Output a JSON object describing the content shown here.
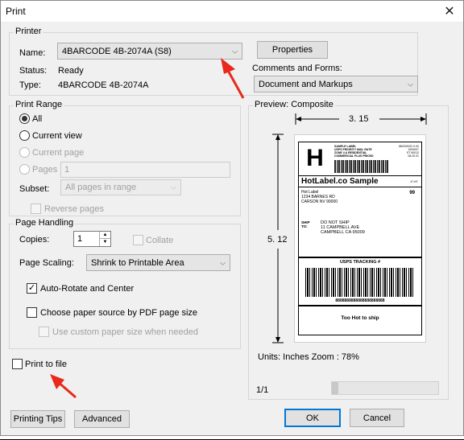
{
  "window": {
    "title": "Print",
    "close_glyph": "✕"
  },
  "printer": {
    "group_label": "Printer",
    "name_label": "Name:",
    "name_value": "4BARCODE 4B-2074A (S8)",
    "status_label": "Status:",
    "status_value": "Ready",
    "type_label": "Type:",
    "type_value": "4BARCODE 4B-2074A",
    "properties_button": "Properties",
    "comments_label": "Comments and Forms:",
    "comments_value": "Document and Markups"
  },
  "print_range": {
    "group_label": "Print Range",
    "all_label": "All",
    "current_view_label": "Current view",
    "current_page_label": "Current page",
    "pages_label": "Pages",
    "pages_value": "1",
    "subset_label": "Subset:",
    "subset_value": "All pages in range",
    "reverse_label": "Reverse pages"
  },
  "page_handling": {
    "group_label": "Page Handling",
    "copies_label": "Copies:",
    "copies_value": "1",
    "collate_label": "Collate",
    "scaling_label": "Page Scaling:",
    "scaling_value": "Shrink to Printable Area",
    "auto_rotate_label": "Auto-Rotate and Center",
    "paper_source_label": "Choose paper source by PDF page size",
    "custom_paper_label": "Use custom paper size when needed"
  },
  "print_to_file_label": "Print to file",
  "preview": {
    "label": "Preview: Composite",
    "width_dim": "3. 15",
    "height_dim": "5. 12",
    "units_text": "Units: Inches Zoom :  78%",
    "page_indicator": "1/1"
  },
  "label_sample": {
    "big_letter": "H",
    "header_lines": [
      "SAMPLE LABEL",
      "USPS PRIORITY MAIL RATE",
      "ZONE 4 & RESIDENTIAL",
      "COMMERCIAL PLUS PRICED"
    ],
    "header_right": [
      "08/23/2022 0.00",
      "1000007",
      "ST 90012",
      "08.20.01"
    ],
    "brand": "HotLabel.co Sample",
    "brand_suffix": "4\"×6\"",
    "from_lines": [
      "Hot Label",
      "1234 BARNES RD",
      "CARSON NV 90000"
    ],
    "from_right": "99",
    "ship_label": "SHIP\nTO:",
    "to_lines": [
      "DO NOT SHIP",
      "11 CAMPBELL AVE",
      "CAMPBELL CA 95009"
    ],
    "tracking_title": "USPS TRACKING #",
    "tracking_number": "8888888888888888888888",
    "footer": "Too Hot to ship"
  },
  "buttons": {
    "printing_tips": "Printing Tips",
    "advanced": "Advanced",
    "ok": "OK",
    "cancel": "Cancel"
  },
  "colors": {
    "accent": "#0078d7",
    "annotation_arrow": "#e8291c"
  }
}
